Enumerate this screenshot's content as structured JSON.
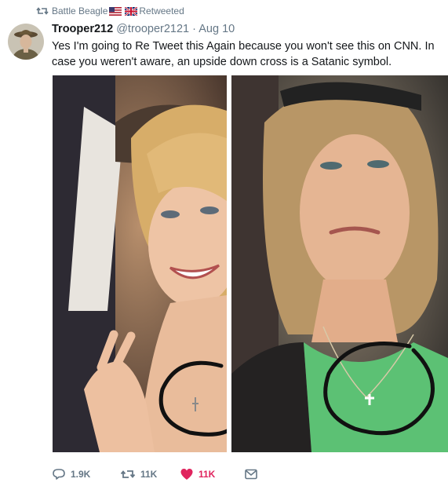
{
  "retweet_banner": {
    "retweeter": "Battle Beagle",
    "label": "Retweeted",
    "icon": "retweet-icon",
    "flags": [
      "us-flag",
      "uk-flag"
    ]
  },
  "tweet": {
    "display_name": "Trooper212",
    "handle": "@trooper2121",
    "separator": "·",
    "date": "Aug 10",
    "text": "Yes I'm going to Re Tweet this Again because you won't see this on CNN. In case you weren't aware, an upside down cross is a Satanic symbol."
  },
  "actions": {
    "reply_count": "1.9K",
    "retweet_count": "11K",
    "like_count": "11K",
    "icons": [
      "reply-icon",
      "retweet-icon",
      "heart-icon",
      "message-icon"
    ]
  },
  "colors": {
    "secondary_text": "#657786",
    "like_active": "#e0245e",
    "annotation_circle": "#000000",
    "shirt_green": "#5cc174"
  }
}
